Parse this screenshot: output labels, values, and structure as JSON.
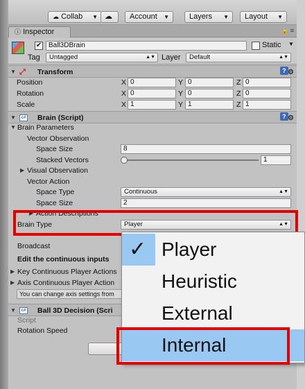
{
  "toolbar": {
    "collab": "Collab",
    "account": "Account",
    "layers": "Layers",
    "layout": "Layout"
  },
  "tab": {
    "label": "Inspector"
  },
  "object": {
    "name": "Ball3DBrain",
    "static_label": "Static",
    "tag_label": "Tag",
    "tag_value": "Untagged",
    "layer_label": "Layer",
    "layer_value": "Default"
  },
  "transform": {
    "title": "Transform",
    "rows": [
      {
        "label": "Position",
        "x": "0",
        "y": "0",
        "z": "0"
      },
      {
        "label": "Rotation",
        "x": "0",
        "y": "0",
        "z": "0"
      },
      {
        "label": "Scale",
        "x": "1",
        "y": "1",
        "z": "1"
      }
    ],
    "axis_x": "X",
    "axis_y": "Y",
    "axis_z": "Z"
  },
  "brain": {
    "title": "Brain (Script)",
    "params": "Brain Parameters",
    "vector_obs": "Vector Observation",
    "space_size_label": "Space Size",
    "space_size_value": "8",
    "stacked_label": "Stacked Vectors",
    "stacked_value": "1",
    "visual_obs": "Visual Observation",
    "vector_action": "Vector Action",
    "space_type_label": "Space Type",
    "space_type_value": "Continuous",
    "action_size_label": "Space Size",
    "action_size_value": "2",
    "action_desc": "Action Descriptions",
    "brain_type_label": "Brain Type",
    "brain_type_value": "Player",
    "broadcast": "Broadcast",
    "edit_inputs": "Edit the continuous inputs",
    "key_actions": "Key Continuous Player Actions",
    "axis_actions": "Axis Continuous Player Action",
    "help_text": "You can change axis settings from"
  },
  "decision": {
    "title": "Ball 3D Decision (Scri",
    "script_label": "Script",
    "rotation_label": "Rotation Speed"
  },
  "menu": {
    "options": [
      "Player",
      "Heuristic",
      "External",
      "Internal"
    ],
    "selected": "Player",
    "highlighted": "Internal",
    "check": "✓"
  },
  "colors": {
    "highlight_box": "#e30000",
    "selection": "#99c9f3"
  }
}
